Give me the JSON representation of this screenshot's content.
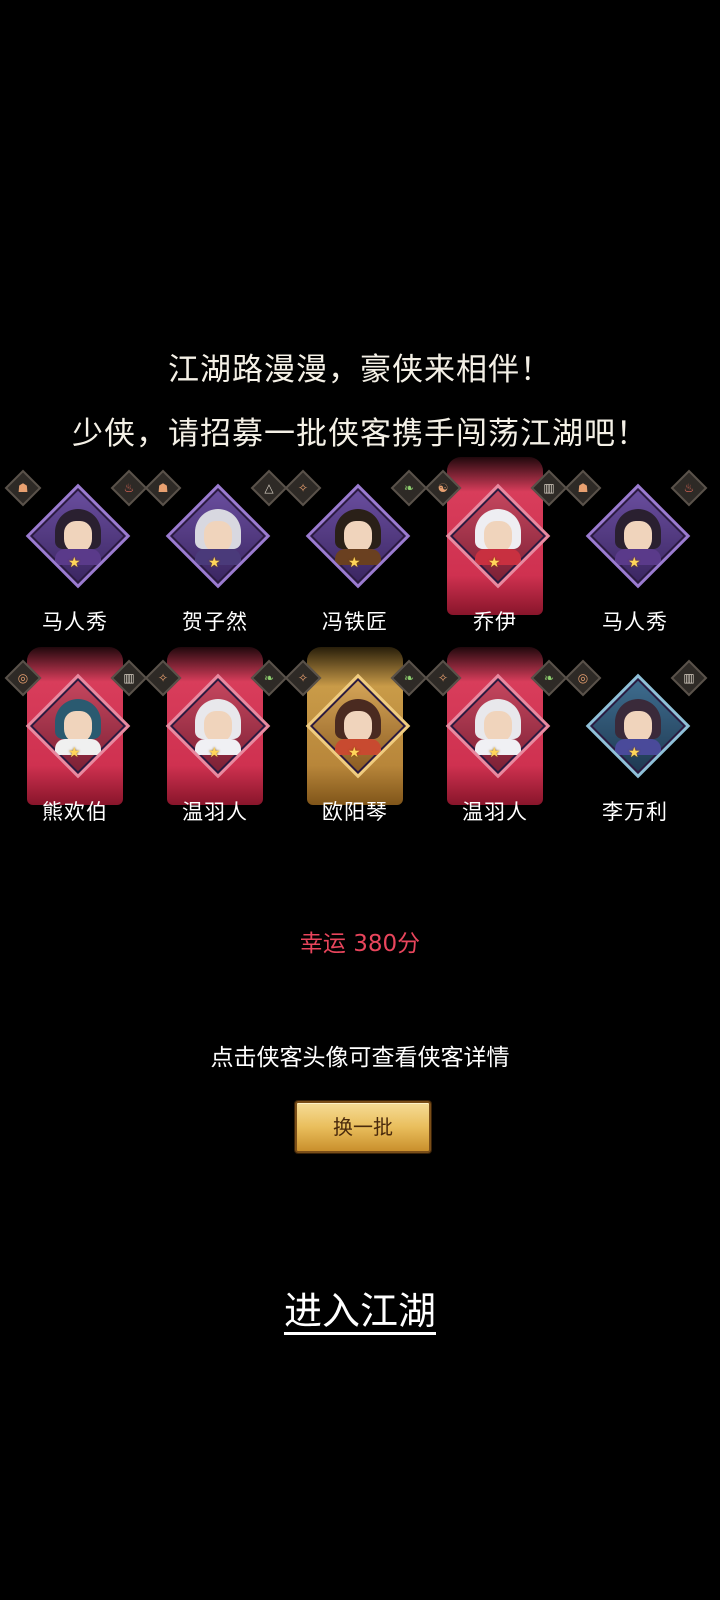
{
  "intro": {
    "line1": "江湖路漫漫，豪侠来相伴！",
    "line2": "少侠，请招募一批侠客携手闯荡江湖吧！"
  },
  "heroes": [
    {
      "name": "马人秀",
      "frame": "purple",
      "glow": "none",
      "hair": "#2a2030",
      "robe": "#5a3a8a",
      "left_icon": "fist-icon",
      "left_symbol": "☗",
      "left_color": "orange",
      "right_icon": "flame-icon",
      "right_symbol": "♨",
      "right_color": "red"
    },
    {
      "name": "贺子然",
      "frame": "purple",
      "glow": "none",
      "hair": "#d8d8e0",
      "robe": "#4a3a7a",
      "left_icon": "fist-icon",
      "left_symbol": "☗",
      "left_color": "orange",
      "right_icon": "mountain-icon",
      "right_symbol": "△",
      "right_color": "gray"
    },
    {
      "name": "冯铁匠",
      "frame": "purple",
      "glow": "none",
      "hair": "#2a2018",
      "robe": "#6a4020",
      "left_icon": "taiji-fist-icon",
      "left_symbol": "✧",
      "left_color": "orange",
      "right_icon": "leaf-icon",
      "right_symbol": "❧",
      "right_color": "green"
    },
    {
      "name": "乔伊",
      "frame": "red",
      "glow": "red",
      "hair": "#eeeef2",
      "robe": "#c83040",
      "left_icon": "yin-yang-icon",
      "left_symbol": "☯",
      "left_color": "orange",
      "right_icon": "wall-icon",
      "right_symbol": "▥",
      "right_color": "gray"
    },
    {
      "name": "马人秀",
      "frame": "purple",
      "glow": "none",
      "hair": "#2a2030",
      "robe": "#5a3a8a",
      "left_icon": "fist-icon",
      "left_symbol": "☗",
      "left_color": "orange",
      "right_icon": "flame-icon",
      "right_symbol": "♨",
      "right_color": "red"
    },
    {
      "name": "熊欢伯",
      "frame": "red",
      "glow": "red",
      "hair": "#2a5a70",
      "robe": "#f0f0f0",
      "left_icon": "target-icon",
      "left_symbol": "◎",
      "left_color": "orange",
      "right_icon": "wall-icon",
      "right_symbol": "▥",
      "right_color": "gray"
    },
    {
      "name": "温羽人",
      "frame": "red",
      "glow": "red",
      "hair": "#e8e8ec",
      "robe": "#f0f0f4",
      "left_icon": "taiji-fist-icon",
      "left_symbol": "✧",
      "left_color": "orange",
      "right_icon": "leaf-icon",
      "right_symbol": "❧",
      "right_color": "green"
    },
    {
      "name": "欧阳琴",
      "frame": "gold",
      "glow": "gold",
      "hair": "#4a2a20",
      "robe": "#c84a30",
      "left_icon": "taiji-fist-icon",
      "left_symbol": "✧",
      "left_color": "orange",
      "right_icon": "leaf-icon",
      "right_symbol": "❧",
      "right_color": "green"
    },
    {
      "name": "温羽人",
      "frame": "red",
      "glow": "red",
      "hair": "#e8e8ec",
      "robe": "#f0f0f4",
      "left_icon": "taiji-fist-icon",
      "left_symbol": "✧",
      "left_color": "orange",
      "right_icon": "leaf-icon",
      "right_symbol": "❧",
      "right_color": "green"
    },
    {
      "name": "李万利",
      "frame": "blue",
      "glow": "none",
      "hair": "#3a2a3a",
      "robe": "#4a4a9a",
      "left_icon": "target-icon",
      "left_symbol": "◎",
      "left_color": "orange",
      "right_icon": "wall-icon",
      "right_symbol": "▥",
      "right_color": "gray"
    }
  ],
  "luck_text": "幸运 380分",
  "hint_text": "点击侠客头像可查看侠客详情",
  "swap_button_label": "换一批",
  "enter_label": "进入江湖",
  "colors": {
    "luck": "#e8455c",
    "glow_red": "#d83d5b",
    "glow_gold": "#c99b48",
    "button_gold": "#e9be5c"
  }
}
